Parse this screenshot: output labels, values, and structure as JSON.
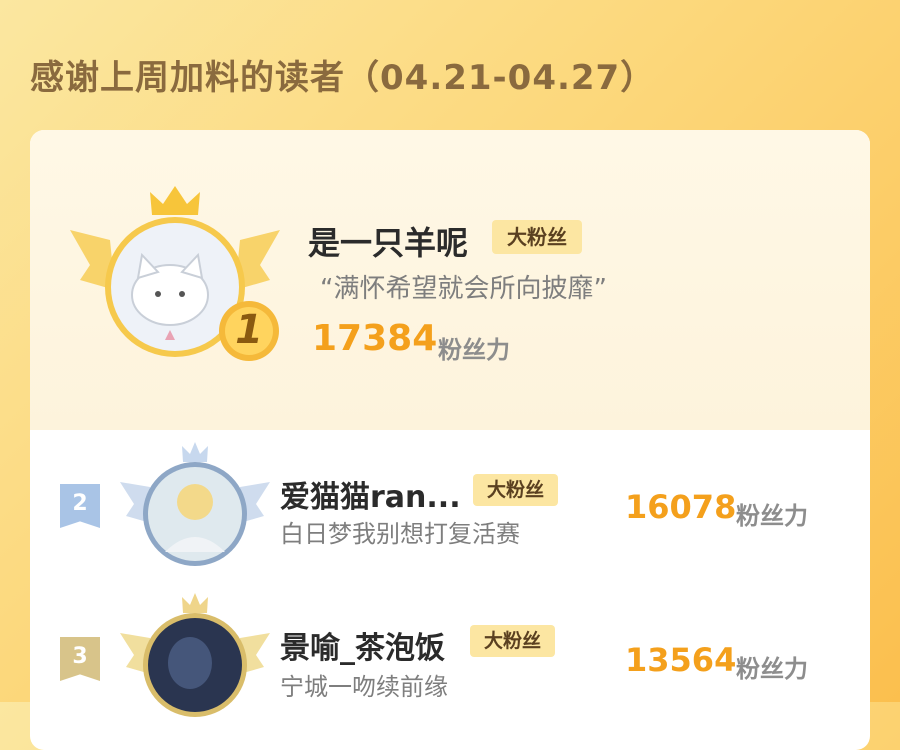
{
  "header": {
    "title": "感谢上周加料的读者（04.21-04.27）"
  },
  "rankings": [
    {
      "rank": "1",
      "name": "是一只羊呢",
      "badge": "大粉丝",
      "quote": "“满怀希望就会所向披靡”",
      "score": "17384",
      "unit": "粉丝力"
    },
    {
      "rank": "2",
      "name": "爱猫猫ran...",
      "badge": "大粉丝",
      "subtitle": "白日梦我别想打复活赛",
      "score": "16078",
      "unit": "粉丝力"
    },
    {
      "rank": "3",
      "name": "景喻_茶泡饭",
      "badge": "大粉丝",
      "subtitle": "宁城一吻续前缘",
      "score": "13564",
      "unit": "粉丝力"
    }
  ],
  "colors": {
    "accent": "#f4a01c",
    "badge_bg": "#fce6a2",
    "heading": "#8a6a3e"
  }
}
